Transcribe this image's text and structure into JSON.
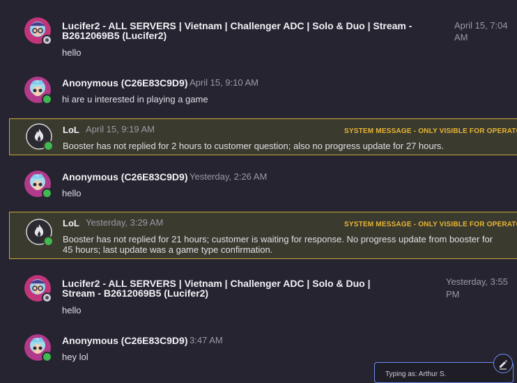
{
  "messages": [
    {
      "name": "Lucifer2 - ALL SERVERS | Vietnam | Challenger ADC | Solo & Duo | Stream - B2612069B5 (Lucifer2)",
      "time": "April 15, 7:04 AM",
      "text": "hello"
    },
    {
      "name": "Anonymous (C26E83C9D9)",
      "time": "April 15, 9:10 AM",
      "text": "hi are u interested in playing a game"
    },
    {
      "system": true,
      "name": "LoL",
      "time": "April 15, 9:19 AM",
      "label": "SYSTEM MESSAGE - ONLY VISIBLE FOR OPERATORS",
      "text": "Booster has not replied for 2 hours to customer question; also no progress update for 27 hours."
    },
    {
      "name": "Anonymous (C26E83C9D9)",
      "time": "Yesterday, 2:26 AM",
      "text": "hello"
    },
    {
      "system": true,
      "name": "LoL",
      "time": "Yesterday, 3:29 AM",
      "label": "SYSTEM MESSAGE - ONLY VISIBLE FOR OPERATORS",
      "text": "Booster has not replied for 21 hours; customer is waiting for response. No progress update from booster for 45 hours; last update was a game type confirmation."
    },
    {
      "name": "Lucifer2 - ALL SERVERS | Vietnam | Challenger ADC | Solo & Duo | Stream - B2612069B5 (Lucifer2)",
      "time": "Yesterday, 3:55 PM",
      "text": "hello"
    },
    {
      "name": "Anonymous (C26E83C9D9)",
      "time": "3:47 AM",
      "text": "hey lol"
    }
  ],
  "composer": {
    "typing_as": "Typing as: Arthur S."
  },
  "icons": {
    "edit": "edit-pencil-icon",
    "system_avatar": "flame-icon"
  },
  "colors": {
    "background": "#252430",
    "system_border": "#c9a93a",
    "system_label": "#e8b634",
    "online": "#3fb950",
    "accent": "#6d8ef5"
  }
}
